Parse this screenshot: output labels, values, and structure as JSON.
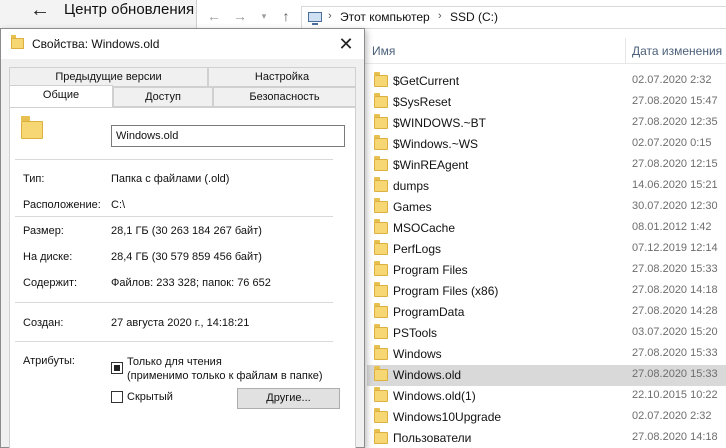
{
  "settings_window": {
    "back_glyph": "←",
    "title": "Центр обновления"
  },
  "explorer": {
    "nav": {
      "back": "←",
      "forward": "→",
      "recent": "▾",
      "up": "↑"
    },
    "breadcrumb": [
      "Этот компьютер",
      "SSD (C:)"
    ],
    "breadcrumb_separator": "›",
    "columns": {
      "name": "Имя",
      "date": "Дата изменения"
    },
    "files": [
      {
        "name": "$GetCurrent",
        "date": "02.07.2020 2:32"
      },
      {
        "name": "$SysReset",
        "date": "27.08.2020 15:47"
      },
      {
        "name": "$WINDOWS.~BT",
        "date": "27.08.2020 12:35"
      },
      {
        "name": "$Windows.~WS",
        "date": "02.07.2020 0:15"
      },
      {
        "name": "$WinREAgent",
        "date": "27.08.2020 12:15"
      },
      {
        "name": "dumps",
        "date": "14.06.2020 15:21"
      },
      {
        "name": "Games",
        "date": "30.07.2020 12:30"
      },
      {
        "name": "MSOCache",
        "date": "08.01.2012 1:42"
      },
      {
        "name": "PerfLogs",
        "date": "07.12.2019 12:14"
      },
      {
        "name": "Program Files",
        "date": "27.08.2020 15:33"
      },
      {
        "name": "Program Files (x86)",
        "date": "27.08.2020 14:18"
      },
      {
        "name": "ProgramData",
        "date": "27.08.2020 14:28"
      },
      {
        "name": "PSTools",
        "date": "03.07.2020 15:20"
      },
      {
        "name": "Windows",
        "date": "27.08.2020 15:33"
      },
      {
        "name": "Windows.old",
        "date": "27.08.2020 15:33",
        "selected": true
      },
      {
        "name": "Windows.old(1)",
        "date": "22.10.2015 10:22"
      },
      {
        "name": "Windows10Upgrade",
        "date": "02.07.2020 2:32"
      },
      {
        "name": "Пользователи",
        "date": "27.08.2020 14:18"
      }
    ]
  },
  "dialog": {
    "title": "Свойства: Windows.old",
    "close": "✕",
    "tabs_row1": [
      "Предыдущие версии",
      "Настройка"
    ],
    "tabs_row2": [
      "Общие",
      "Доступ",
      "Безопасность"
    ],
    "folder_name": "Windows.old",
    "properties": {
      "type_label": "Тип:",
      "type_value": "Папка с файлами (.old)",
      "location_label": "Расположение:",
      "location_value": "C:\\",
      "size_label": "Размер:",
      "size_value": "28,1 ГБ (30 263 184 267 байт)",
      "disk_label": "На диске:",
      "disk_value": "28,4 ГБ (30 579 859 456 байт)",
      "contains_label": "Содержит:",
      "contains_value": "Файлов: 233 328; папок: 76 652",
      "created_label": "Создан:",
      "created_value": "27 августа 2020 г., 14:18:21"
    },
    "attributes": {
      "label": "Атрибуты:",
      "readonly_label": "Только для чтения",
      "readonly_note": "(применимо только к файлам в папке)",
      "hidden_label": "Скрытый",
      "other_button": "Другие..."
    }
  }
}
